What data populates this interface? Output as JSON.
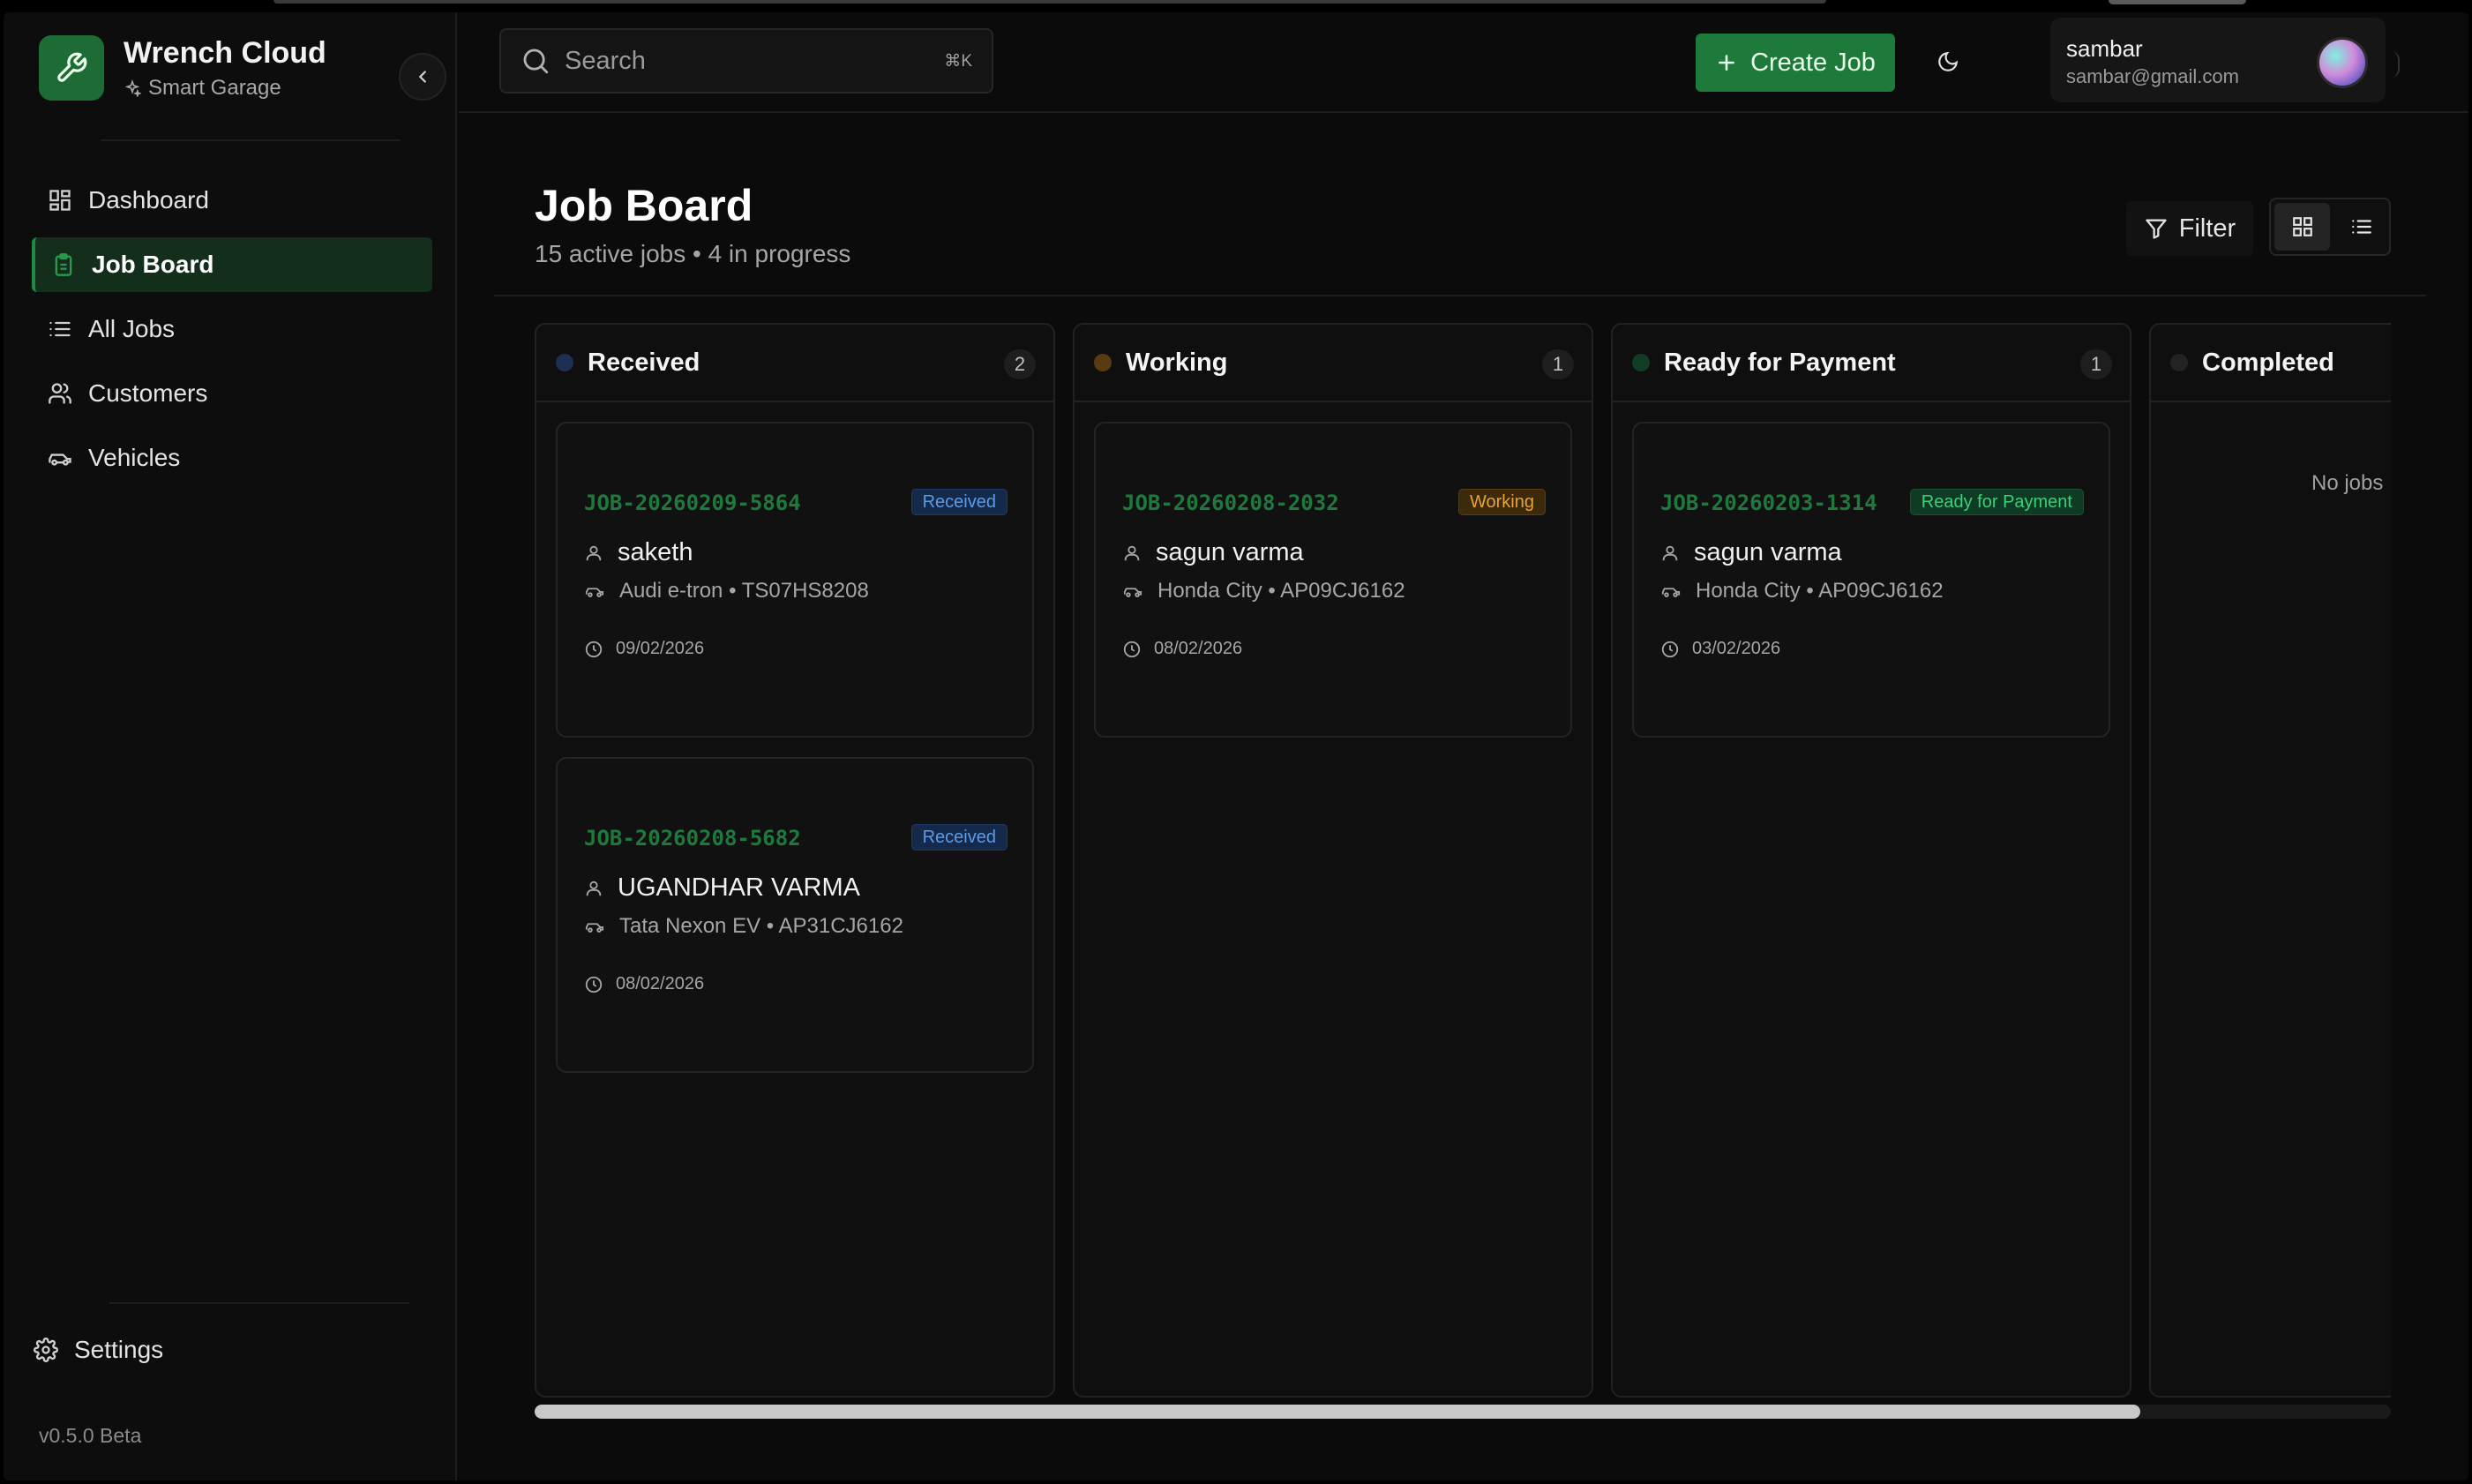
{
  "app": {
    "name": "Wrench Cloud",
    "subtitle": "Smart Garage",
    "version": "v0.5.0 Beta"
  },
  "sidebar": {
    "items": [
      {
        "label": "Dashboard",
        "icon": "dashboard-icon",
        "active": false
      },
      {
        "label": "Job Board",
        "icon": "clipboard-icon",
        "active": true
      },
      {
        "label": "All Jobs",
        "icon": "list-icon",
        "active": false
      },
      {
        "label": "Customers",
        "icon": "users-icon",
        "active": false
      },
      {
        "label": "Vehicles",
        "icon": "car-icon",
        "active": false
      }
    ],
    "settings_label": "Settings"
  },
  "topbar": {
    "search_placeholder": "Search",
    "search_shortcut": "⌘K",
    "create_label": "Create Job",
    "user_name": "sambar",
    "user_email": "sambar@gmail.com"
  },
  "page": {
    "title": "Job Board",
    "subtitle": "15 active jobs • 4 in progress",
    "filter_label": "Filter"
  },
  "columns": [
    {
      "title": "Received",
      "count": "2",
      "color": "#1d2f55",
      "cards": [
        {
          "id": "JOB-20260209-5864",
          "badge": "Received",
          "customer": "saketh",
          "vehicle": "Audi e-tron • TS07HS8208",
          "date": "09/02/2026"
        },
        {
          "id": "JOB-20260208-5682",
          "badge": "Received",
          "customer": "UGANDHAR VARMA",
          "vehicle": "Tata Nexon EV • AP31CJ6162",
          "date": "08/02/2026"
        }
      ]
    },
    {
      "title": "Working",
      "count": "1",
      "color": "#5a3a10",
      "cards": [
        {
          "id": "JOB-20260208-2032",
          "badge": "Working",
          "customer": "sagun varma",
          "vehicle": "Honda City • AP09CJ6162",
          "date": "08/02/2026"
        }
      ]
    },
    {
      "title": "Ready for Payment",
      "count": "1",
      "color": "#123c26",
      "cards": [
        {
          "id": "JOB-20260203-1314",
          "badge": "Ready for Payment",
          "customer": "sagun varma",
          "vehicle": "Honda City • AP09CJ6162",
          "date": "03/02/2026"
        }
      ]
    },
    {
      "title": "Completed",
      "count": "",
      "color": "#232323",
      "empty_text": "No jobs"
    }
  ],
  "colors": {
    "accent": "#1d7a3a",
    "background": "#0b0b0b"
  }
}
